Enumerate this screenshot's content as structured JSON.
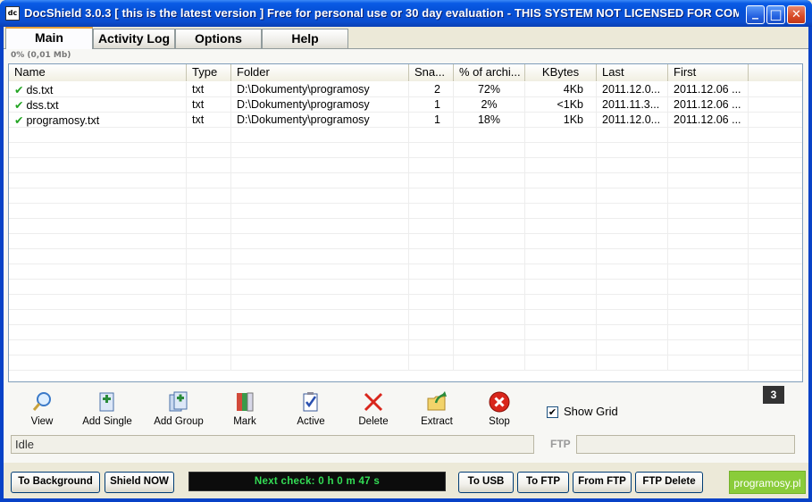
{
  "window": {
    "app_icon": "dc",
    "title": "DocShield 3.0.3  [ this is the latest version ] Free for personal use or 30 day evaluation - THIS SYSTEM NOT LICENSED FOR COM...",
    "minimize": "_",
    "maximize": "□",
    "close": "✕"
  },
  "tabs": [
    {
      "label": "Main",
      "active": true
    },
    {
      "label": "Activity Log"
    },
    {
      "label": "Options"
    },
    {
      "label": "Help"
    }
  ],
  "size_info": "0%  (0,01 Mb)",
  "table": {
    "columns": [
      "Name",
      "Type",
      "Folder",
      "Sna...",
      "% of archi...",
      "KBytes",
      "Last",
      "First"
    ],
    "rows": [
      {
        "name": "ds.txt",
        "type": "txt",
        "folder": "D:\\Dokumenty\\programosy",
        "snapshots": "2",
        "percent": "72%",
        "kbytes": "4Kb",
        "last": "2011.12.0...",
        "first": "2011.12.06 ..."
      },
      {
        "name": "dss.txt",
        "type": "txt",
        "folder": "D:\\Dokumenty\\programosy",
        "snapshots": "1",
        "percent": "2%",
        "kbytes": "<1Kb",
        "last": "2011.11.3...",
        "first": "2011.12.06 ..."
      },
      {
        "name": "programosy.txt",
        "type": "txt",
        "folder": "D:\\Dokumenty\\programosy",
        "snapshots": "1",
        "percent": "18%",
        "kbytes": "1Kb",
        "last": "2011.12.0...",
        "first": "2011.12.06 ..."
      }
    ]
  },
  "toolbar": {
    "view": "View",
    "add_single": "Add Single",
    "add_group": "Add Group",
    "mark": "Mark",
    "active": "Active",
    "delete": "Delete",
    "extract": "Extract",
    "stop": "Stop",
    "show_grid": "Show Grid",
    "show_grid_checked": "✔",
    "badge": "3"
  },
  "status": {
    "text": "Idle",
    "ftp_label": "FTP",
    "ftp_value": ""
  },
  "bottom": {
    "to_background": "To Background",
    "shield_now": "Shield NOW",
    "next_check": "Next check:  0 h 0 m 47 s",
    "to_usb": "To USB",
    "to_ftp": "To FTP",
    "from_ftp": "From FTP",
    "ftp_delete": "FTP Delete",
    "brand": "programosy.pl"
  },
  "colors": {
    "title_blue": "#0A5BE5",
    "check_green": "#23A523",
    "next_check_green": "#33DD55",
    "brand_green": "#8ACC3A",
    "delete_red": "#D9261C",
    "stop_red": "#D9261C"
  }
}
